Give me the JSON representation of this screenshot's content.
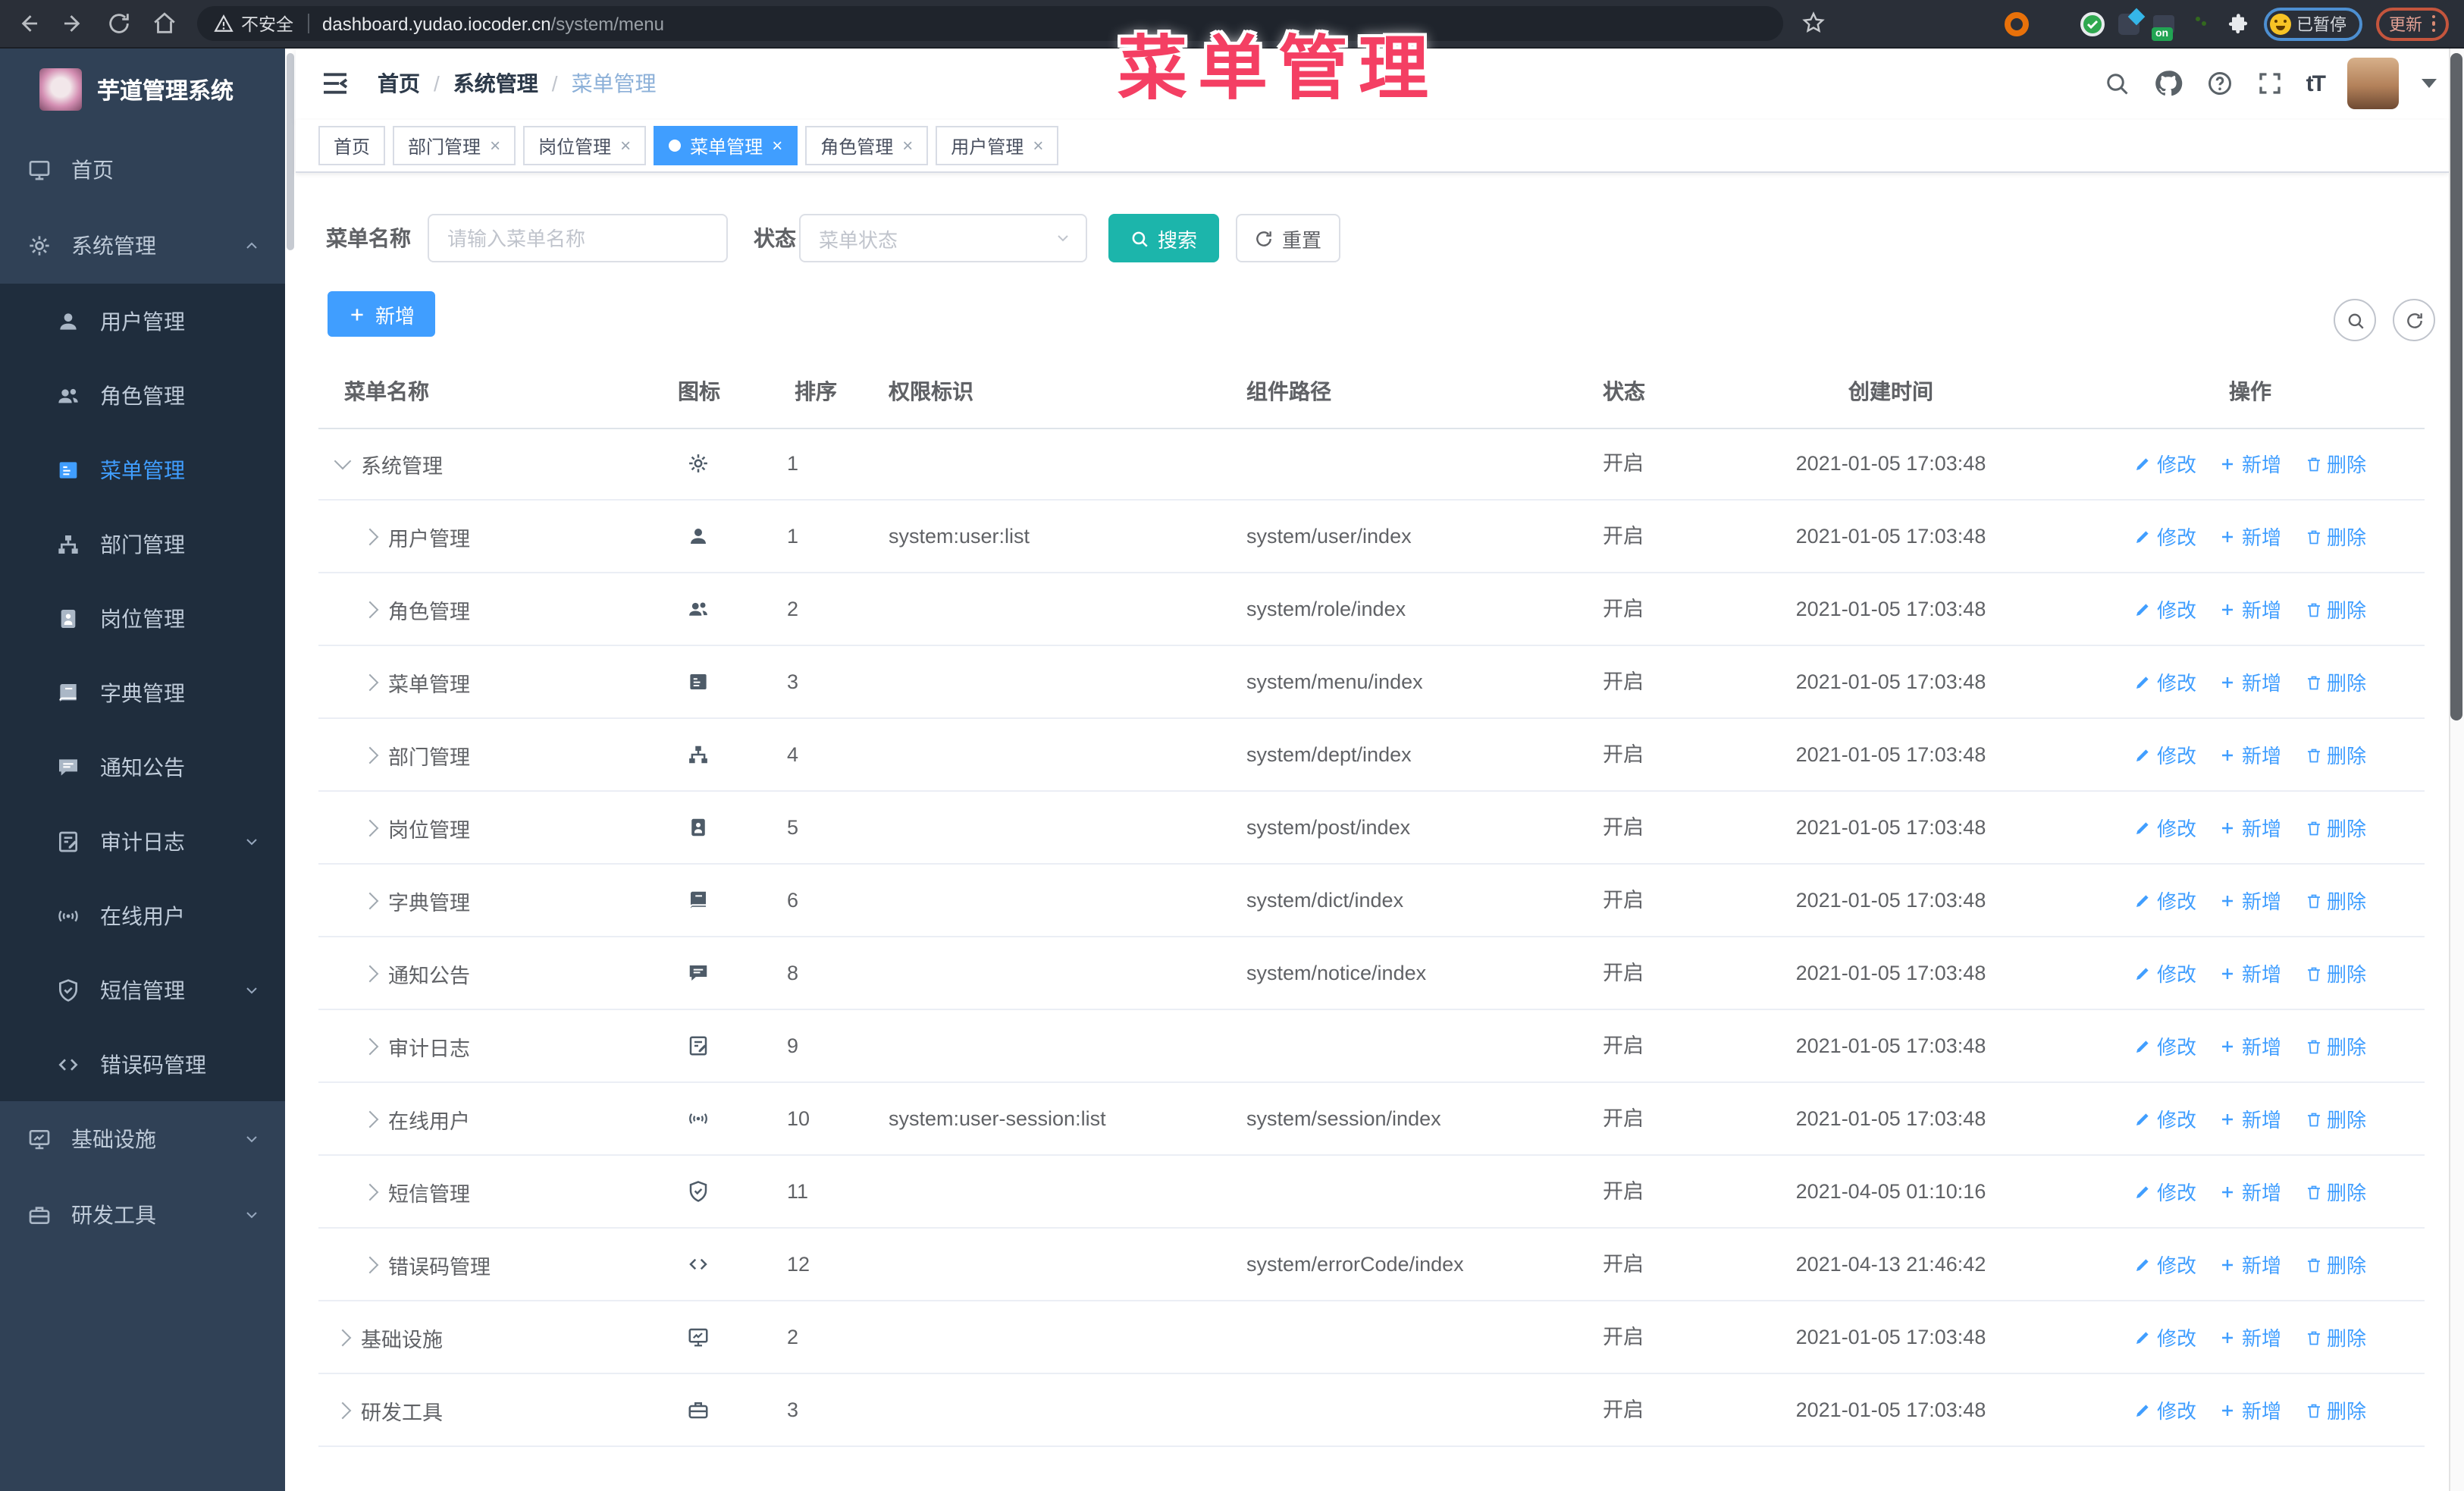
{
  "browser": {
    "security_label": "不安全",
    "url_host": "dashboard.yudao.iocoder.cn",
    "url_path": "/system/menu",
    "extension_on_badge": "on",
    "paused_badge_label": "已暂停",
    "update_button_label": "更新"
  },
  "overlay_title": "菜单管理",
  "colors": {
    "accent": "#409eff",
    "search_teal": "#1cb5ab",
    "overlay_pink": "#f43f63",
    "sidebar_bg": "#304156",
    "submenu_bg": "#1f2d3d"
  },
  "sidebar": {
    "app_title": "芋道管理系统",
    "items": [
      {
        "label": "首页",
        "icon": "home",
        "level": 0
      },
      {
        "label": "系统管理",
        "icon": "gear",
        "level": 0,
        "chevron": "up"
      },
      {
        "label": "用户管理",
        "icon": "user",
        "level": 1
      },
      {
        "label": "角色管理",
        "icon": "users",
        "level": 1
      },
      {
        "label": "菜单管理",
        "icon": "menu",
        "level": 1,
        "active": true
      },
      {
        "label": "部门管理",
        "icon": "tree",
        "level": 1
      },
      {
        "label": "岗位管理",
        "icon": "badge",
        "level": 1
      },
      {
        "label": "字典管理",
        "icon": "book",
        "level": 1
      },
      {
        "label": "通知公告",
        "icon": "message",
        "level": 1
      },
      {
        "label": "审计日志",
        "icon": "editdoc",
        "level": 1,
        "chevron": "down"
      },
      {
        "label": "在线用户",
        "icon": "online",
        "level": 1
      },
      {
        "label": "短信管理",
        "icon": "shield",
        "level": 1,
        "chevron": "down"
      },
      {
        "label": "错误码管理",
        "icon": "code",
        "level": 1
      },
      {
        "label": "基础设施",
        "icon": "monitor",
        "level": 0,
        "chevron": "down"
      },
      {
        "label": "研发工具",
        "icon": "toolbox",
        "level": 0,
        "chevron": "down"
      }
    ]
  },
  "navbar": {
    "breadcrumb": [
      "首页",
      "系统管理",
      "菜单管理"
    ],
    "breadcrumb_separator": "/",
    "font_size_label": "tT"
  },
  "tabs": [
    {
      "label": "首页",
      "closable": false,
      "active": false
    },
    {
      "label": "部门管理",
      "closable": true,
      "active": false
    },
    {
      "label": "岗位管理",
      "closable": true,
      "active": false
    },
    {
      "label": "菜单管理",
      "closable": true,
      "active": true
    },
    {
      "label": "角色管理",
      "closable": true,
      "active": false
    },
    {
      "label": "用户管理",
      "closable": true,
      "active": false
    }
  ],
  "filters": {
    "name_label": "菜单名称",
    "name_placeholder": "请输入菜单名称",
    "status_label": "状态",
    "status_placeholder": "菜单状态",
    "search_label": "搜索",
    "reset_label": "重置",
    "add_label": "新增"
  },
  "table": {
    "columns": [
      "菜单名称",
      "图标",
      "排序",
      "权限标识",
      "组件路径",
      "状态",
      "创建时间",
      "操作"
    ],
    "action_labels": {
      "edit": "修改",
      "add": "新增",
      "delete": "删除"
    },
    "rows": [
      {
        "name": "系统管理",
        "icon": "gear",
        "sort": "1",
        "perm": "",
        "path": "",
        "status": "开启",
        "time": "2021-01-05 17:03:48",
        "level": 0,
        "expanded": true
      },
      {
        "name": "用户管理",
        "icon": "user",
        "sort": "1",
        "perm": "system:user:list",
        "path": "system/user/index",
        "status": "开启",
        "time": "2021-01-05 17:03:48",
        "level": 1
      },
      {
        "name": "角色管理",
        "icon": "users",
        "sort": "2",
        "perm": "",
        "path": "system/role/index",
        "status": "开启",
        "time": "2021-01-05 17:03:48",
        "level": 1
      },
      {
        "name": "菜单管理",
        "icon": "menu",
        "sort": "3",
        "perm": "",
        "path": "system/menu/index",
        "status": "开启",
        "time": "2021-01-05 17:03:48",
        "level": 1
      },
      {
        "name": "部门管理",
        "icon": "tree",
        "sort": "4",
        "perm": "",
        "path": "system/dept/index",
        "status": "开启",
        "time": "2021-01-05 17:03:48",
        "level": 1
      },
      {
        "name": "岗位管理",
        "icon": "badge",
        "sort": "5",
        "perm": "",
        "path": "system/post/index",
        "status": "开启",
        "time": "2021-01-05 17:03:48",
        "level": 1
      },
      {
        "name": "字典管理",
        "icon": "book",
        "sort": "6",
        "perm": "",
        "path": "system/dict/index",
        "status": "开启",
        "time": "2021-01-05 17:03:48",
        "level": 1
      },
      {
        "name": "通知公告",
        "icon": "message",
        "sort": "8",
        "perm": "",
        "path": "system/notice/index",
        "status": "开启",
        "time": "2021-01-05 17:03:48",
        "level": 1
      },
      {
        "name": "审计日志",
        "icon": "editdoc",
        "sort": "9",
        "perm": "",
        "path": "",
        "status": "开启",
        "time": "2021-01-05 17:03:48",
        "level": 1
      },
      {
        "name": "在线用户",
        "icon": "online",
        "sort": "10",
        "perm": "system:user-session:list",
        "path": "system/session/index",
        "status": "开启",
        "time": "2021-01-05 17:03:48",
        "level": 1
      },
      {
        "name": "短信管理",
        "icon": "shield",
        "sort": "11",
        "perm": "",
        "path": "",
        "status": "开启",
        "time": "2021-04-05 01:10:16",
        "level": 1
      },
      {
        "name": "错误码管理",
        "icon": "code",
        "sort": "12",
        "perm": "",
        "path": "system/errorCode/index",
        "status": "开启",
        "time": "2021-04-13 21:46:42",
        "level": 1
      },
      {
        "name": "基础设施",
        "icon": "monitor",
        "sort": "2",
        "perm": "",
        "path": "",
        "status": "开启",
        "time": "2021-01-05 17:03:48",
        "level": 0
      },
      {
        "name": "研发工具",
        "icon": "toolbox",
        "sort": "3",
        "perm": "",
        "path": "",
        "status": "开启",
        "time": "2021-01-05 17:03:48",
        "level": 0
      }
    ]
  }
}
